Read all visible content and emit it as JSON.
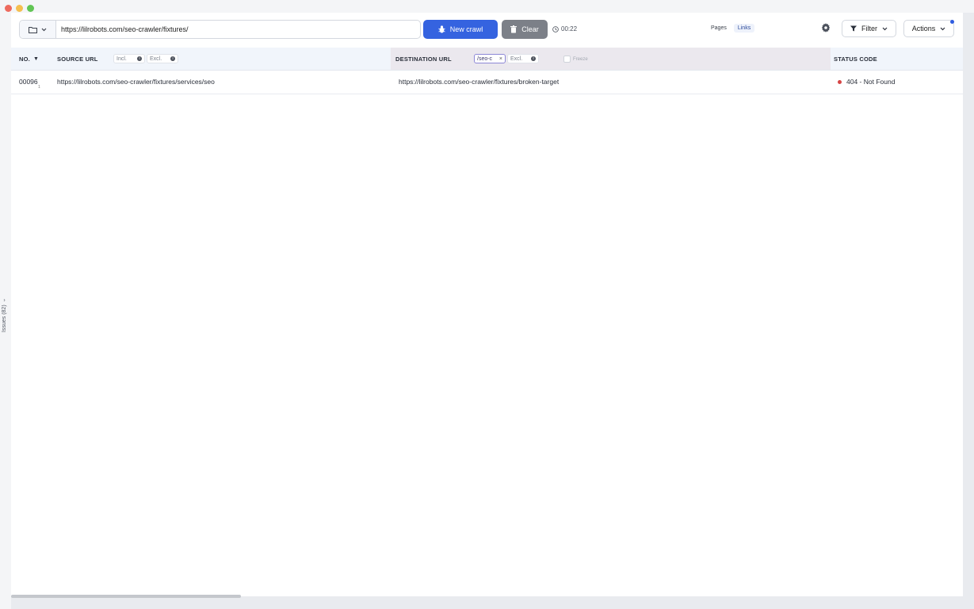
{
  "toolbar": {
    "url_value": "https://lilrobots.com/seo-crawler/fixtures/",
    "new_crawl_label": "New crawl",
    "clear_label": "Clear",
    "timer": "00:22",
    "view_tabs": [
      "Pages",
      "Links"
    ],
    "active_view": "Links",
    "filter_label": "Filter",
    "actions_label": "Actions"
  },
  "sidebar": {
    "issues_label": "Issues (82)"
  },
  "table": {
    "columns": {
      "no": "NO.",
      "source": "SOURCE URL",
      "destination": "DESTINATION URL",
      "status": "STATUS CODE"
    },
    "source_incl_placeholder": "Incl.",
    "source_excl_placeholder": "Excl.",
    "dest_incl_value": "/seo-c",
    "dest_excl_placeholder": "Excl.",
    "freeze_label": "Freeze",
    "rows": [
      {
        "no": "00096",
        "sub": "1",
        "source": "https://lilrobots.com/seo-crawler/fixtures/services/seo",
        "destination": "https://lilrobots.com/seo-crawler/fixtures/broken-target",
        "status": "404 - Not Found"
      }
    ]
  },
  "colors": {
    "primary": "#3563e0",
    "error": "#d64545",
    "secondary": "#7c8088"
  }
}
